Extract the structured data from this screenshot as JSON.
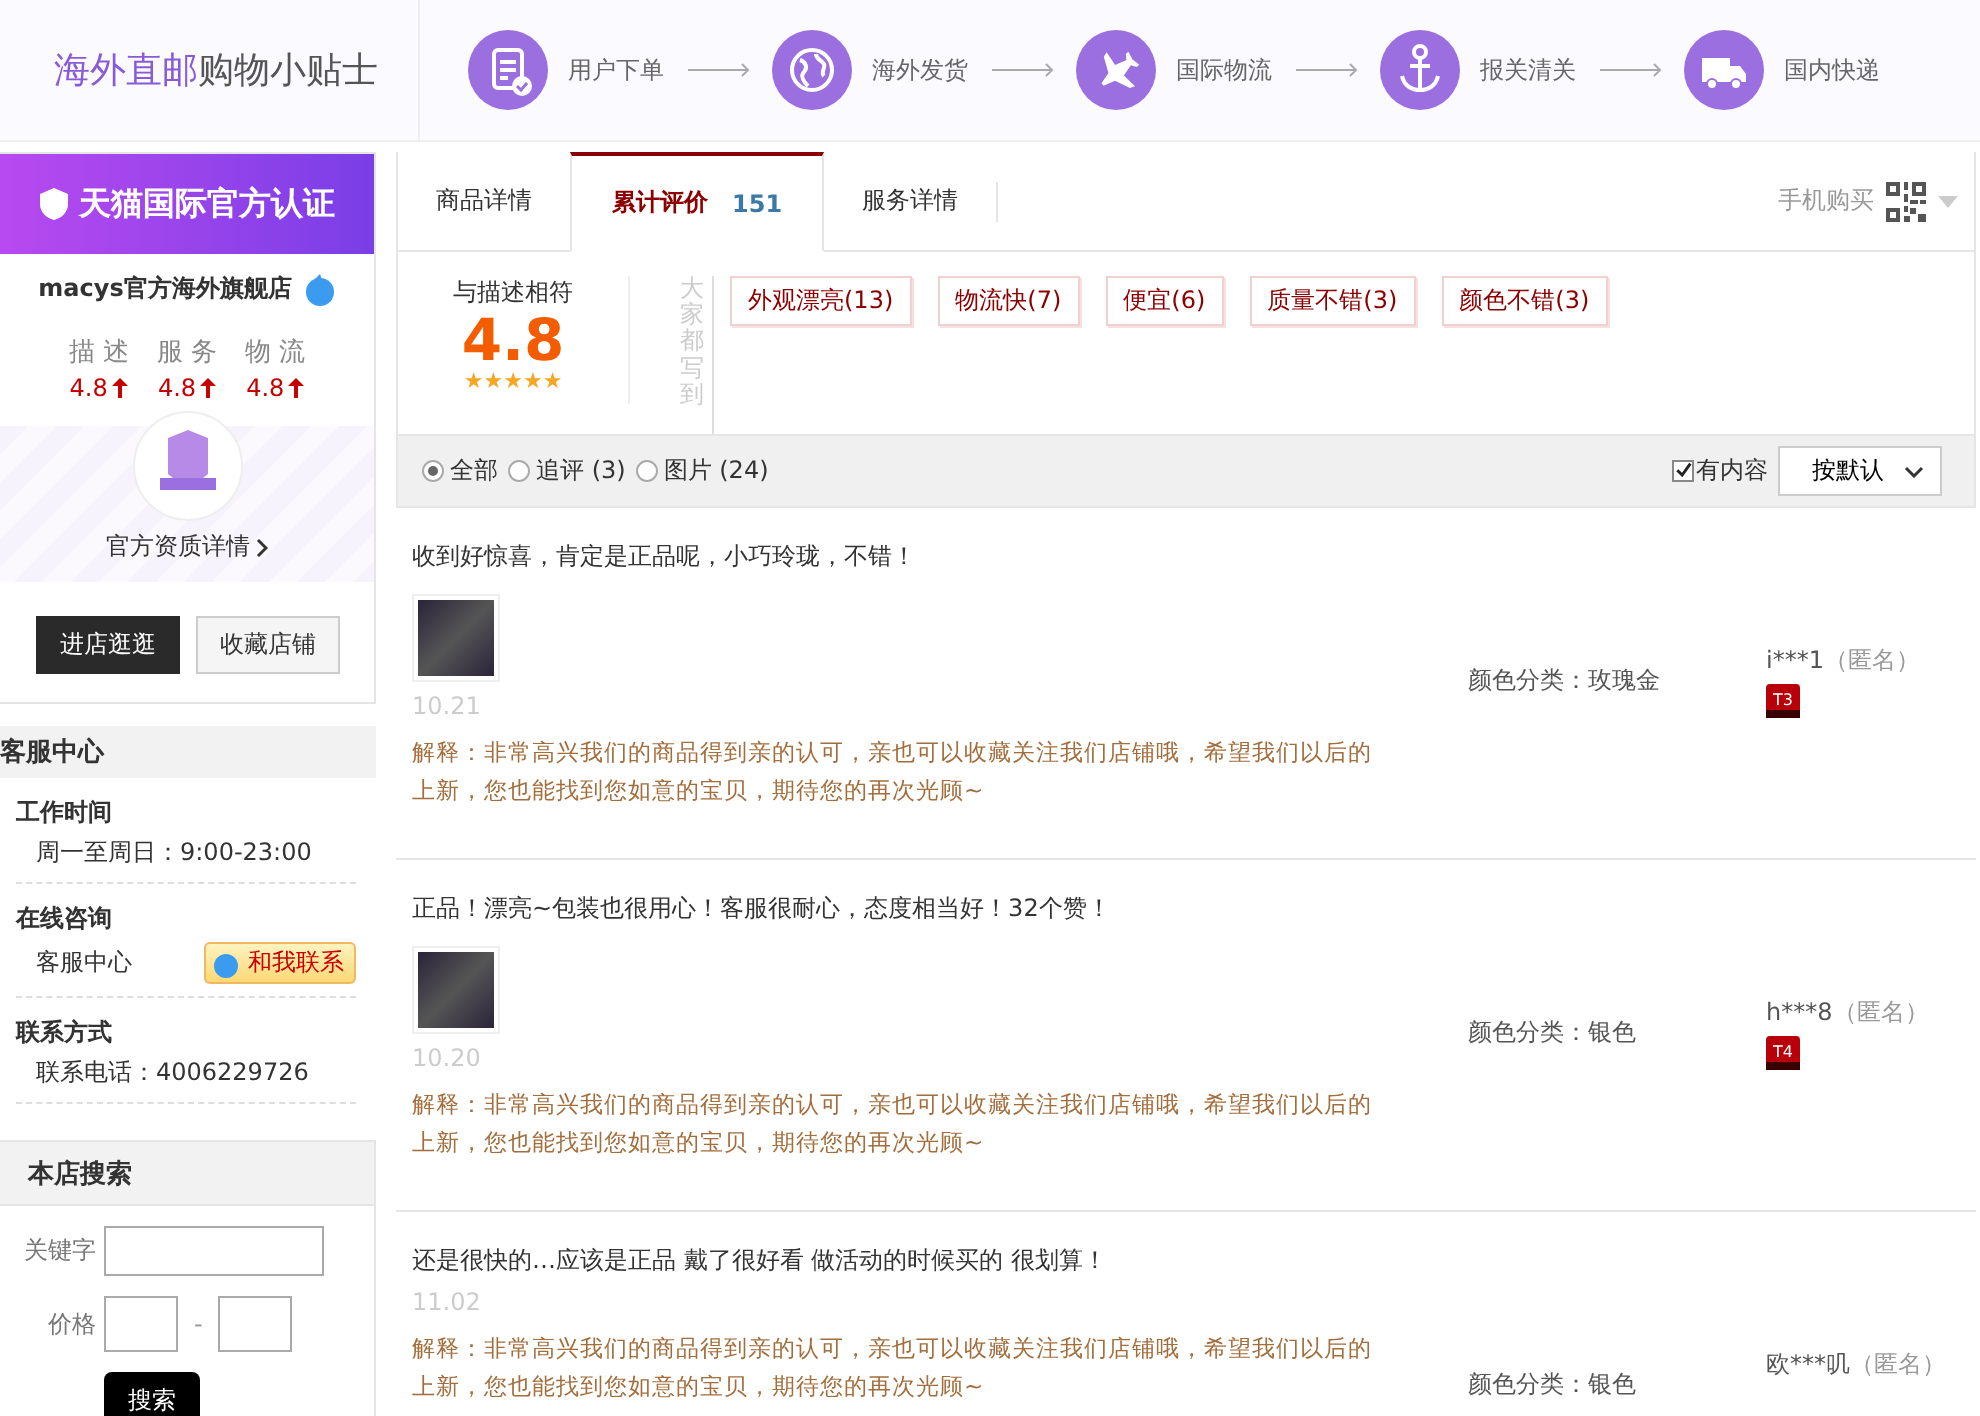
{
  "banner": {
    "title_highlight": "海外直邮",
    "title_rest": "购物小贴士",
    "steps": [
      {
        "kind": "order",
        "label": "用户下单"
      },
      {
        "kind": "ship",
        "label": "海外发货"
      },
      {
        "kind": "flight",
        "label": "国际物流"
      },
      {
        "kind": "customs",
        "label": "报关清关"
      },
      {
        "kind": "delivery",
        "label": "国内快递"
      }
    ]
  },
  "store": {
    "certification": "天猫国际官方认证",
    "name": "macys官方海外旗舰店",
    "ratings": [
      {
        "label": "描 述",
        "value": "4.8"
      },
      {
        "label": "服 务",
        "value": "4.8"
      },
      {
        "label": "物 流",
        "value": "4.8"
      }
    ],
    "qualification_link": "官方资质详情",
    "buttons": [
      {
        "label": "进店逛逛",
        "kind": "primary"
      },
      {
        "label": "收藏店铺",
        "kind": "secondary"
      }
    ]
  },
  "service": {
    "title": "客服中心",
    "sections": [
      {
        "heading": "工作时间",
        "text": "周一至周日：9:00-23:00"
      },
      {
        "heading": "在线咨询",
        "text": "客服中心",
        "contact_button": "和我联系"
      },
      {
        "heading": "联系方式",
        "text": "联系电话：4006229726"
      }
    ]
  },
  "shop_search": {
    "title": "本店搜索",
    "keyword_label": "关键字",
    "price_label": "价格",
    "price_separator": "-",
    "button": "搜索"
  },
  "tabs": [
    {
      "label": "商品详情",
      "selected": false
    },
    {
      "label": "累计评价",
      "count": "151",
      "selected": true
    },
    {
      "label": "服务详情",
      "selected": false
    }
  ],
  "mobile_buy": "手机购买",
  "summary": {
    "label": "与描述相符",
    "score": "4.8",
    "stars": 5,
    "tags_caption": "大家都写到",
    "tags": [
      "外观漂亮(13)",
      "物流快(7)",
      "便宜(6)",
      "质量不错(3)",
      "颜色不错(3)"
    ]
  },
  "filters": {
    "options": [
      {
        "label": "全部",
        "selected": true
      },
      {
        "label": "追评 (3)",
        "selected": false
      },
      {
        "label": "图片 (24)",
        "selected": false
      }
    ],
    "with_content": {
      "label": "有内容",
      "checked": true
    },
    "sort": "按默认"
  },
  "reviews": [
    {
      "text": "收到好惊喜，肯定是正品呢，小巧玲珑，不错！",
      "date": "10.21",
      "reply": "解释：非常高兴我们的商品得到亲的认可，亲也可以收藏关注我们店铺哦，希望我们以后的上新，您也能找到您如意的宝贝，期待您的再次光顾~",
      "has_photo": true,
      "spec": "颜色分类：玫瑰金",
      "user": "i***1",
      "anonymous": "（匿名）",
      "tier": "T3"
    },
    {
      "text": "正品！漂亮~包装也很用心！客服很耐心，态度相当好！32个赞！",
      "date": "10.20",
      "reply": "解释：非常高兴我们的商品得到亲的认可，亲也可以收藏关注我们店铺哦，希望我们以后的上新，您也能找到您如意的宝贝，期待您的再次光顾~",
      "has_photo": true,
      "spec": "颜色分类：银色",
      "user": "h***8",
      "anonymous": "（匿名）",
      "tier": "T4"
    },
    {
      "text": "还是很快的…应该是正品 戴了很好看 做活动的时候买的 很划算！",
      "date": "11.02",
      "reply": "解释：非常高兴我们的商品得到亲的认可，亲也可以收藏关注我们店铺哦，希望我们以后的上新，您也能找到您如意的宝贝，期待您的再次光顾~",
      "has_photo": false,
      "spec": "颜色分类：银色",
      "user": "欧***叽",
      "anonymous": "（匿名）"
    }
  ]
}
